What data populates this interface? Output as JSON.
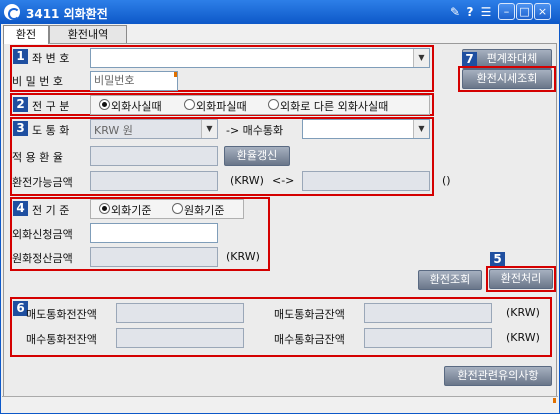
{
  "window": {
    "title": "3411 외화환전"
  },
  "tabs": [
    {
      "label": "환전"
    },
    {
      "label": "환전내역"
    }
  ],
  "section1": {
    "num": "1",
    "account_label": "좌 변 호",
    "password_label": "비 밀 번 호",
    "password_placeholder": "비밀번호"
  },
  "section2": {
    "num": "2",
    "label": "전 구 분",
    "options": [
      "외화사실때",
      "외화파실때",
      "외화로 다른 외화사실때"
    ],
    "selected": "외화사실때"
  },
  "section3": {
    "num": "3",
    "currency_label": "도 통 화",
    "currency_value": "KRW 원",
    "arrow_text": "-> 매수통화",
    "rate_label": "적 용 환 율",
    "rate_button": "환율갱신",
    "available_label": "환전가능금액",
    "krw_unit": "(KRW)",
    "swap_symbol": "<->",
    "paren_unit": "()"
  },
  "section4": {
    "num": "4",
    "label": "전 기 준",
    "options": [
      "외화기준",
      "원화기준"
    ],
    "selected": "외화기준",
    "request_label": "외화신청금액",
    "settle_label": "원화정산금액",
    "krw_unit": "(KRW)"
  },
  "side_buttons": {
    "account_replace": "편계좌대체",
    "rate_view": "환전시세조회",
    "num7": "7"
  },
  "actions": {
    "exchange_query": "환전조회",
    "exchange_process": "환전처리",
    "num5": "5"
  },
  "section6": {
    "num": "6",
    "sell_balance_label": "매도통화전잔액",
    "sell_after_label": "매도통화금잔액",
    "buy_balance_label": "매수통화전잔액",
    "buy_after_label": "매수통화금잔액",
    "krw_unit": "(KRW)"
  },
  "notice_button": "환전관련유의사항"
}
